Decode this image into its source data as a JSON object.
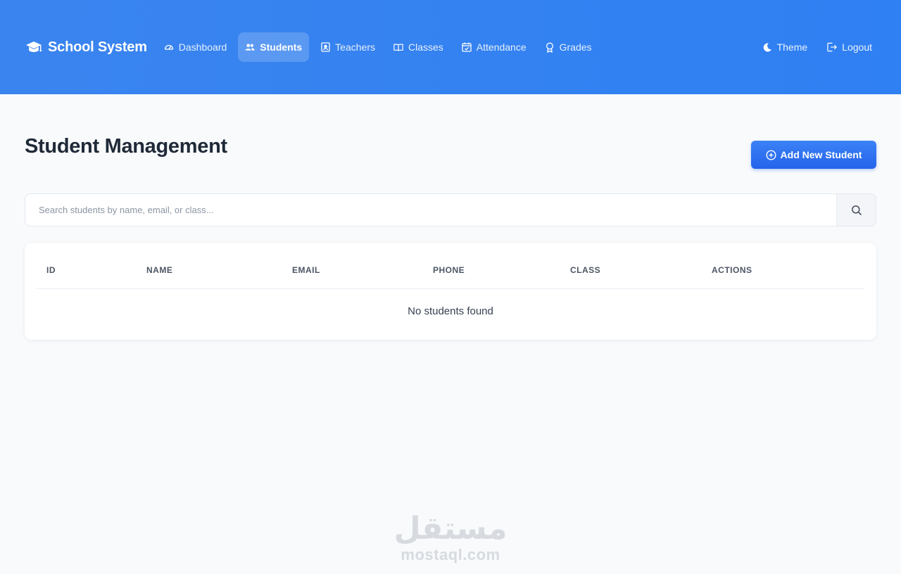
{
  "brand": {
    "name": "School System",
    "icon": "graduation-cap-icon"
  },
  "nav": {
    "items": [
      {
        "label": "Dashboard",
        "icon": "speedometer-icon",
        "active": false
      },
      {
        "label": "Students",
        "icon": "people-icon",
        "active": true
      },
      {
        "label": "Teachers",
        "icon": "person-badge-icon",
        "active": false
      },
      {
        "label": "Classes",
        "icon": "book-icon",
        "active": false
      },
      {
        "label": "Attendance",
        "icon": "calendar-check-icon",
        "active": false
      },
      {
        "label": "Grades",
        "icon": "award-icon",
        "active": false
      }
    ],
    "theme_label": "Theme",
    "logout_label": "Logout"
  },
  "page": {
    "title": "Student Management",
    "add_button_label": "Add New Student"
  },
  "search": {
    "placeholder": "Search students by name, email, or class...",
    "value": ""
  },
  "table": {
    "columns": [
      "ID",
      "NAME",
      "EMAIL",
      "PHONE",
      "CLASS",
      "ACTIONS"
    ],
    "rows": [],
    "empty_message": "No students found"
  },
  "watermark": {
    "arabic": "مستقل",
    "latin": "mostaql.com"
  },
  "colors": {
    "primary": "#2f80f3",
    "button": "#2563eb",
    "background": "#f8fafc"
  }
}
